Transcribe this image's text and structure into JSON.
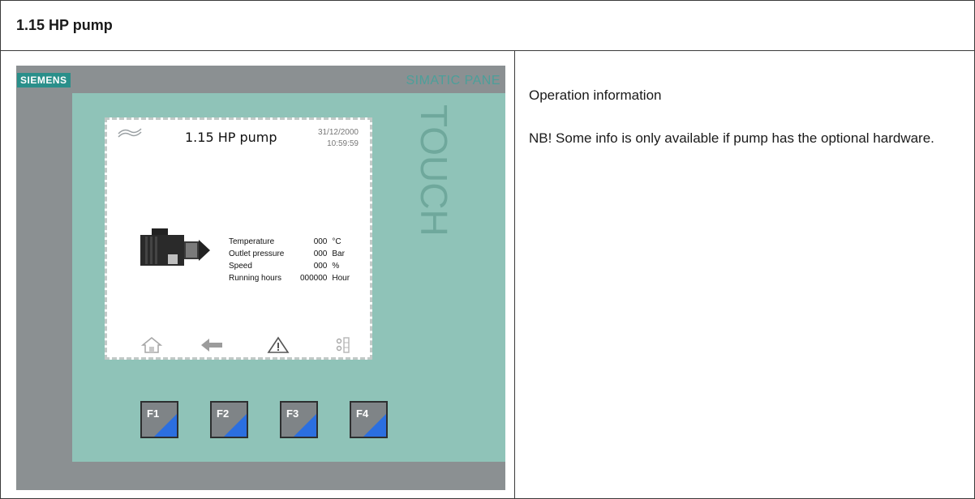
{
  "document": {
    "title": "1.15 HP pump",
    "description": "Operation information",
    "note": "NB! Some info is only available if pump has the optional hardware."
  },
  "panel": {
    "brand": "SIEMENS",
    "product": "SIMATIC PANE",
    "bezel_text": "TOUCH",
    "screen": {
      "title": "1.15 HP pump",
      "date": "31/12/2000",
      "time": "10:59:59",
      "readings": [
        {
          "label": "Temperature",
          "value": "000",
          "unit": "°C"
        },
        {
          "label": "Outlet pressure",
          "value": "000",
          "unit": "Bar"
        },
        {
          "label": "Speed",
          "value": "000",
          "unit": "%"
        },
        {
          "label": "Running hours",
          "value": "000000",
          "unit": "Hour"
        }
      ],
      "nav_icons": [
        "home-icon",
        "back-arrow-icon",
        "warning-icon",
        "tools-icon"
      ]
    },
    "function_keys": [
      "F1",
      "F2",
      "F3",
      "F4"
    ]
  },
  "colors": {
    "panel_gray": "#8b9092",
    "bezel_green": "#8fc3b8",
    "brand_teal": "#2a8f8a",
    "key_accent_blue": "#2b6fe0"
  }
}
